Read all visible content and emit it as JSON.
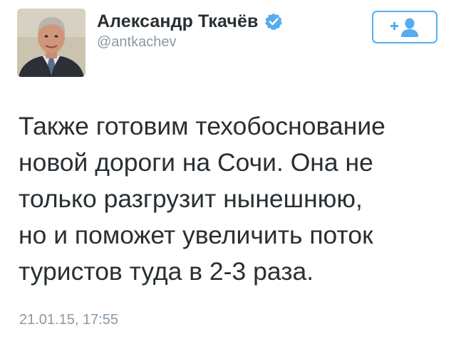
{
  "author": {
    "display_name": "Александр Ткачёв",
    "handle": "@antkachev",
    "verified": true,
    "avatar_icon": "profile-photo"
  },
  "follow_button": {
    "icon": "add-user-icon",
    "color": "#55acee"
  },
  "tweet": {
    "lines": [
      "Также готовим техобоснование",
      "новой дороги на Сочи. Она не",
      "только разгрузит нынешнюю,",
      "но и поможет увеличить поток",
      "туристов туда в 2-3 раза."
    ],
    "timestamp": "21.01.15, 17:55"
  },
  "colors": {
    "text": "#292f33",
    "secondary": "#8899a6",
    "accent": "#55acee"
  }
}
